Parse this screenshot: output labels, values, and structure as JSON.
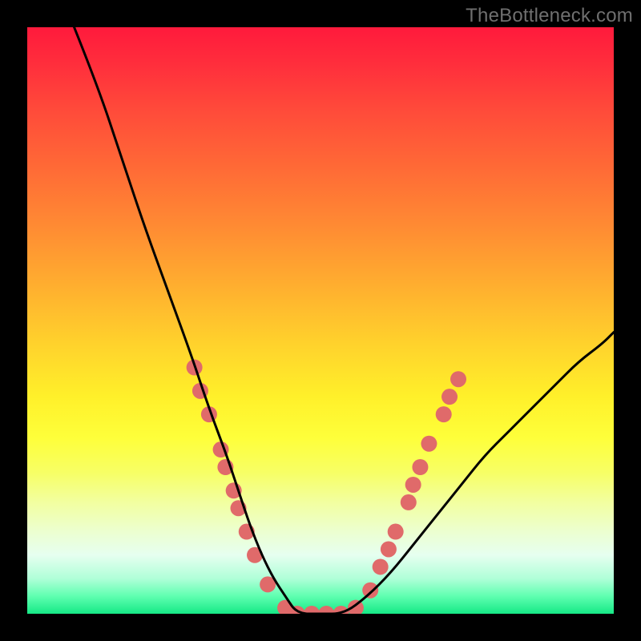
{
  "watermark": "TheBottleneck.com",
  "chart_data": {
    "type": "line",
    "title": "",
    "xlabel": "",
    "ylabel": "",
    "xlim": [
      0,
      100
    ],
    "ylim": [
      0,
      100
    ],
    "grid": false,
    "legend": false,
    "background_gradient": {
      "direction": "vertical",
      "stops": [
        {
          "pos": 0.0,
          "color": "#ff1a3c"
        },
        {
          "pos": 0.14,
          "color": "#ff4a3a"
        },
        {
          "pos": 0.34,
          "color": "#ff8b33"
        },
        {
          "pos": 0.54,
          "color": "#ffd22c"
        },
        {
          "pos": 0.7,
          "color": "#feff3a"
        },
        {
          "pos": 0.86,
          "color": "#ecffd0"
        },
        {
          "pos": 1.0,
          "color": "#16e986"
        }
      ]
    },
    "series": [
      {
        "name": "bottleneck-curve",
        "stroke": "#000000",
        "x": [
          8,
          12,
          16,
          20,
          24,
          28,
          31,
          34,
          36,
          38,
          40,
          42,
          44,
          46,
          50,
          54,
          58,
          62,
          66,
          70,
          74,
          78,
          82,
          86,
          90,
          94,
          98,
          100
        ],
        "y": [
          100,
          90,
          78,
          66,
          55,
          44,
          35,
          27,
          21,
          15,
          10,
          6,
          3,
          0,
          0,
          0,
          3,
          7,
          12,
          17,
          22,
          27,
          31,
          35,
          39,
          43,
          46,
          48
        ]
      }
    ],
    "markers": {
      "name": "highlighted-points",
      "shape": "circle",
      "fill": "#e06a6a",
      "radius_px": 10,
      "points": [
        {
          "x": 28.5,
          "y": 42
        },
        {
          "x": 29.5,
          "y": 38
        },
        {
          "x": 31.0,
          "y": 34
        },
        {
          "x": 33.0,
          "y": 28
        },
        {
          "x": 33.8,
          "y": 25
        },
        {
          "x": 35.2,
          "y": 21
        },
        {
          "x": 36.0,
          "y": 18
        },
        {
          "x": 37.4,
          "y": 14
        },
        {
          "x": 38.8,
          "y": 10
        },
        {
          "x": 41.0,
          "y": 5
        },
        {
          "x": 44.0,
          "y": 1
        },
        {
          "x": 46.0,
          "y": 0
        },
        {
          "x": 48.5,
          "y": 0
        },
        {
          "x": 51.0,
          "y": 0
        },
        {
          "x": 53.5,
          "y": 0
        },
        {
          "x": 56.0,
          "y": 1
        },
        {
          "x": 58.5,
          "y": 4
        },
        {
          "x": 60.2,
          "y": 8
        },
        {
          "x": 61.6,
          "y": 11
        },
        {
          "x": 62.8,
          "y": 14
        },
        {
          "x": 65.0,
          "y": 19
        },
        {
          "x": 65.8,
          "y": 22
        },
        {
          "x": 67.0,
          "y": 25
        },
        {
          "x": 68.5,
          "y": 29
        },
        {
          "x": 71.0,
          "y": 34
        },
        {
          "x": 72.0,
          "y": 37
        },
        {
          "x": 73.5,
          "y": 40
        }
      ]
    }
  }
}
